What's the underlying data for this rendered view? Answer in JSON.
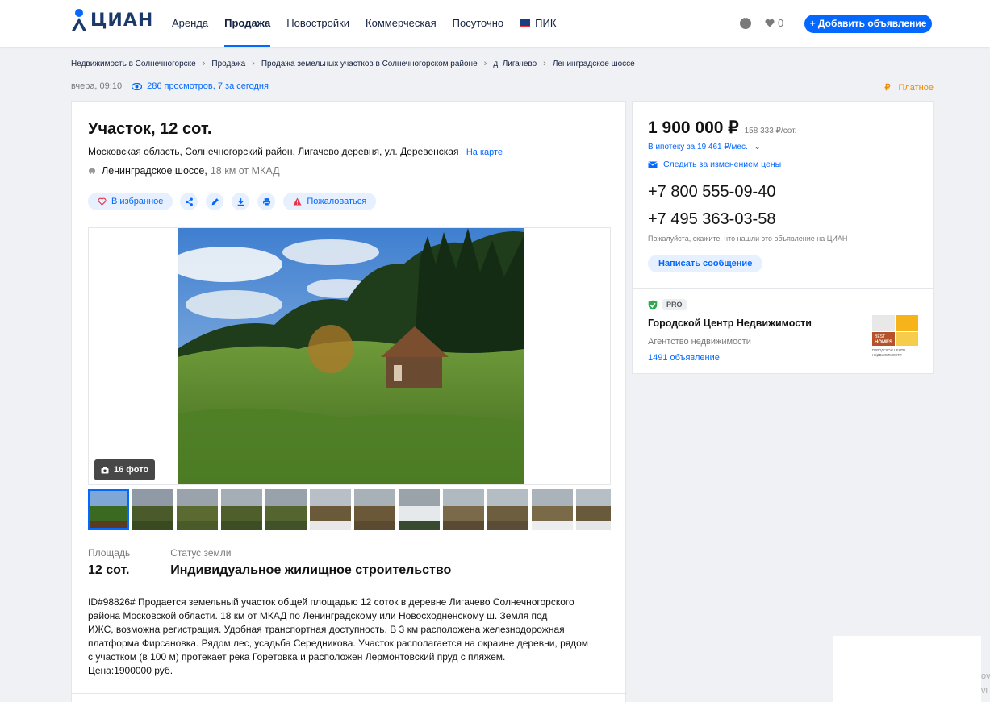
{
  "header": {
    "logo_text": "ЦИАН",
    "nav": [
      "Аренда",
      "Продажа",
      "Новостройки",
      "Коммерческая",
      "Посуточно",
      "ПИК"
    ],
    "active_nav": "Продажа",
    "favorites_count": "0",
    "add_button": "+ Добавить объявление"
  },
  "breadcrumbs": [
    "Недвижимость в Солнечногорске",
    "Продажа",
    "Продажа земельных участков в Солнечногорском районе",
    "д. Лигачево",
    "Ленинградское шоссе"
  ],
  "meta": {
    "published": "вчера, 09:10",
    "views": "286 просмотров, 7 за сегодня",
    "paid_label": "Платное",
    "paid_symbol": "₽"
  },
  "listing": {
    "title": "Участок, 12 сот.",
    "address": "Московская область, Солнечногорский район, Лигачево деревня, ул. Деревенская",
    "map_link": "На карте",
    "highway": "Ленинградское шоссе,",
    "distance": "18 км от МКАД",
    "actions": {
      "favorite": "В избранное",
      "complain": "Пожаловаться"
    },
    "photo_count": "16 фото",
    "thumbnail_count": 12,
    "facts": [
      {
        "label": "Площадь",
        "value": "12 сот."
      },
      {
        "label": "Статус земли",
        "value": "Индивидуальное жилищное строительство"
      }
    ],
    "description": "ID#98826# Продается земельный участок общей площадью 12 соток в деревне Лигачево Солнечногорского\nрайона Московской области. 18 км от МКАД по Ленинградскому или Новосходненскому ш. Земля под\nИЖС, возможна регистрация. Удобная транспортная доступность. В 3 км расположена железнодорожная\nплатформа Фирсановка. Рядом лес, усадьба Середникова. Участок располагается на окраине деревни, рядом\nс участком (в 100 м) протекает река Горетовка и расположен Лермонтовский пруд с пляжем.\nЦена:1900000 руб."
  },
  "sidebar": {
    "price": "1 900 000 ₽",
    "price_per": "158 333 ₽/сот.",
    "mortgage": "В ипотеку за 19 461 ₽/мес.",
    "follow": "Следить за изменением цены",
    "phones": [
      "+7 800 555-09-40",
      "+7 495 363-03-58"
    ],
    "note": "Пожалуйста, скажите, что нашли это объявление на ЦИАН",
    "message_button": "Написать сообщение",
    "pro_badge": "PRO",
    "agency_name": "Городской Центр Недвижимости",
    "agency_type": "Агентство недвижимости",
    "agency_listings": "1491 объявление",
    "agency_logo_text": [
      "BEST",
      "HOMES",
      "ГОРОДСКОЙ ЦЕНТР",
      "НЕДВИЖИМОСТИ"
    ]
  },
  "colors": {
    "accent": "#0468ff",
    "paid": "#f08a00",
    "verified": "#2fa84f"
  },
  "corner_fragment": [
    "ov",
    "vi"
  ]
}
